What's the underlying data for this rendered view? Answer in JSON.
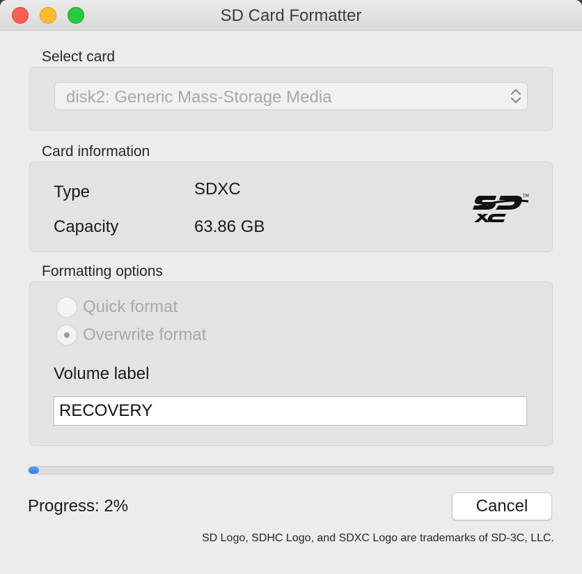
{
  "window": {
    "title": "SD Card Formatter"
  },
  "select_card": {
    "section_label": "Select card",
    "selected": "disk2: Generic Mass-Storage Media"
  },
  "card_info": {
    "section_label": "Card information",
    "type_label": "Type",
    "type_value": "SDXC",
    "capacity_label": "Capacity",
    "capacity_value": "63.86 GB",
    "logo": "sdxc-logo"
  },
  "formatting": {
    "section_label": "Formatting options",
    "quick_label": "Quick format",
    "overwrite_label": "Overwrite format",
    "selected_option": "overwrite",
    "volume_label_title": "Volume label",
    "volume_label_value": "RECOVERY"
  },
  "progress": {
    "percent": 2,
    "text": "Progress: 2%"
  },
  "buttons": {
    "cancel_label": "Cancel"
  },
  "footer": {
    "text": "SD Logo, SDHC Logo, and SDXC Logo are trademarks of SD-3C, LLC."
  },
  "colors": {
    "accent": "#2f7fe6",
    "close": "#fd5f57",
    "minimize": "#febc2e",
    "maximize": "#28c840"
  }
}
